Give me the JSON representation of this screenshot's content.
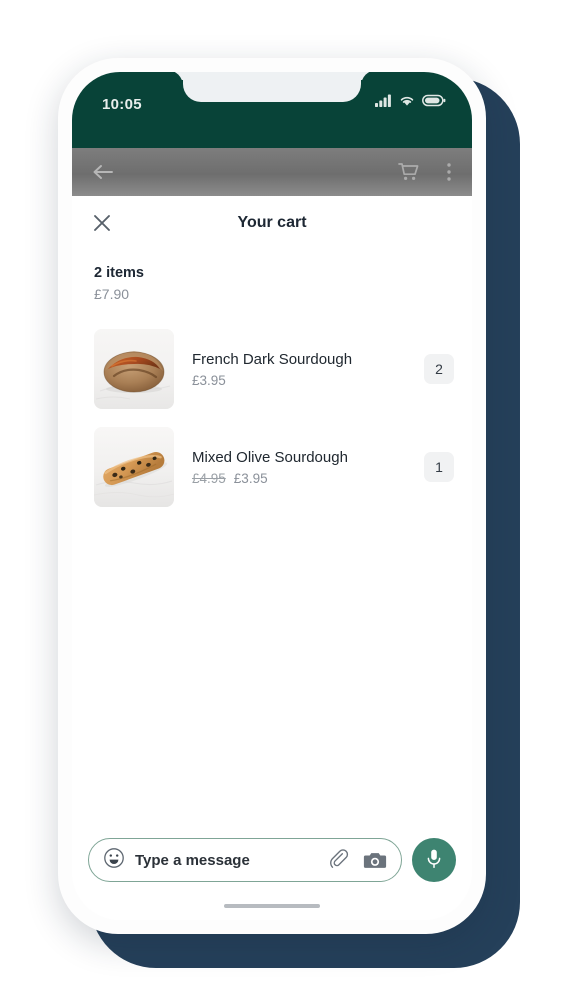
{
  "status_bar": {
    "time": "10:05",
    "icons": [
      "signal-icon",
      "wifi-icon",
      "battery-icon"
    ]
  },
  "toolbar": {
    "back_icon": "back-arrow-icon",
    "cart_icon": "shopping-cart-icon",
    "overflow_icon": "more-vertical-icon"
  },
  "sheet": {
    "close_icon": "close-icon",
    "title": "Your cart"
  },
  "summary": {
    "count_label": "2 items",
    "total": "£7.90"
  },
  "cart_items": [
    {
      "name": "French Dark Sourdough",
      "price": "£3.95",
      "old_price": "",
      "quantity": "2",
      "image": "round-sourdough-loaf"
    },
    {
      "name": "Mixed Olive Sourdough",
      "price": "£3.95",
      "old_price": "£4.95",
      "quantity": "1",
      "image": "olive-baguette"
    }
  ],
  "composer": {
    "emoji_icon": "smiley-face-icon",
    "placeholder": "Type a message",
    "attach_icon": "paperclip-icon",
    "camera_icon": "camera-icon",
    "mic_icon": "microphone-icon"
  },
  "colors": {
    "status_bar_green": "#084338",
    "mic_green": "#3e8471",
    "backdrop_navy": "#25405a",
    "toolbar_gray": "#6e6e6e",
    "qty_badge": "#f1f2f3"
  }
}
